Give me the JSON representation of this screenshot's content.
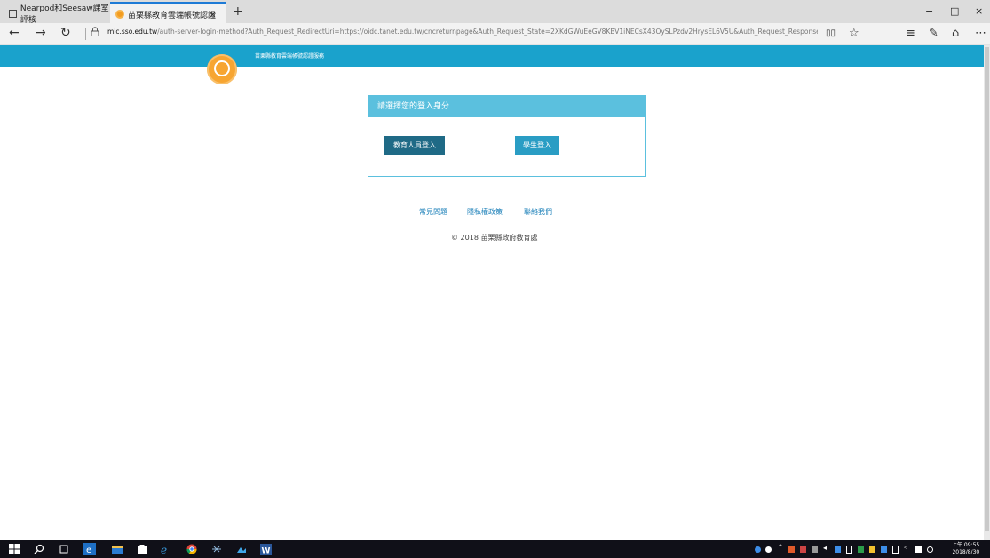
{
  "browser": {
    "tabs": [
      {
        "label": "Nearpod和Seesaw課室評核",
        "active": false
      },
      {
        "label": "苗栗縣教育雲端帳號認證",
        "active": true
      }
    ],
    "new_tab_label": "+",
    "close_tab_label": "×",
    "window_controls": [
      "−",
      "□",
      "×"
    ],
    "url_host": "mlc.sso.edu.tw",
    "url_rest": "/auth-server-login-method?Auth_Request_RedirectUri=https://oidc.tanet.edu.tw/cncreturnpage&Auth_Request_State=2XKdGWuEeGV8KBV1iNECsX43OySLPzdv2HrysEL6V5U&Auth_Request_Response_Type=code&Auth_",
    "nav": {
      "back": "←",
      "forward": "→",
      "refresh": "↻",
      "lock": "🔒"
    },
    "tools": [
      "▯▯",
      "☆",
      "≡",
      "✎",
      "⌂",
      "⋯"
    ]
  },
  "page": {
    "banner_title": "苗栗縣教育雲端帳號認證服務",
    "login_header": "請選擇您的登入身分",
    "buttons": {
      "staff": "教育人員登入",
      "student": "學生登入"
    },
    "footer_links": [
      "常見問題",
      "隱私權政策",
      "聯絡我們"
    ],
    "copyright": "© 2018 苗栗縣政府教育處"
  },
  "colors": {
    "banner": "#1aa2cc",
    "card_header": "#5bc0de",
    "staff_button": "#1f6a86",
    "student_button": "#2a9dc4",
    "link": "#1a7fb8"
  },
  "taskbar": {
    "clock_time": "上午 09:55",
    "clock_date": "2018/8/30"
  }
}
